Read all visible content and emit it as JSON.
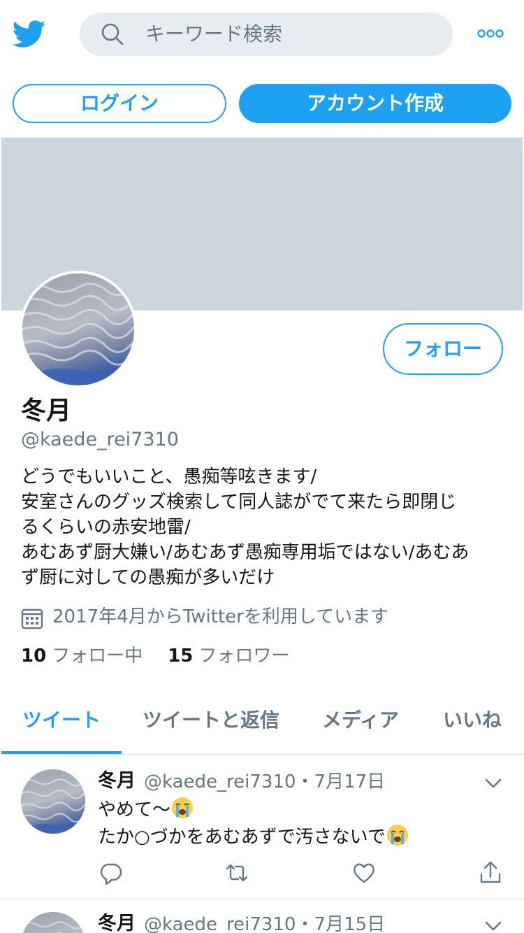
{
  "header": {
    "search_placeholder": "キーワード検索",
    "login_label": "ログイン",
    "signup_label": "アカウント作成"
  },
  "profile": {
    "name": "冬月",
    "handle": "@kaede_rei7310",
    "follow_label": "フォロー",
    "bio_lines": [
      "どうでもいいこと、愚痴等呟きます/",
      "安室さんのグッズ検索して同人誌がでて来たら即閉じ",
      "るくらいの赤安地雷/",
      "あむあず厨大嫌い/あむあず愚痴専用垢ではない/あむあ",
      "ず厨に対しての愚痴が多いだけ"
    ],
    "joined": "2017年4月からTwitterを利用しています",
    "following_count": "10",
    "following_label": "フォロー中",
    "followers_count": "15",
    "followers_label": "フォロワー"
  },
  "tabs": [
    {
      "label": "ツイート",
      "active": true
    },
    {
      "label": "ツイートと返信",
      "active": false
    },
    {
      "label": "メディア",
      "active": false
    },
    {
      "label": "いいね",
      "active": false
    }
  ],
  "tweets": [
    {
      "name": "冬月",
      "meta": "@kaede_rei7310・7月17日",
      "lines": [
        "やめて～",
        "たか○づかをあむあずで汚さないで"
      ],
      "emoji": "loudly-crying-face"
    },
    {
      "name": "冬月",
      "meta": "@kaede_rei7310・7月15日"
    }
  ],
  "icons": {
    "logo": "twitter-bird-icon",
    "search": "search-icon",
    "more": "more-dots-icon",
    "calendar": "calendar-icon",
    "chevron": "chevron-down-icon",
    "reply": "reply-icon",
    "retweet": "retweet-icon",
    "like": "heart-icon",
    "share": "share-icon"
  },
  "colors": {
    "accent": "#1da1f2",
    "muted_text": "#657786",
    "banner": "#ccd6dd",
    "search_bg": "#e6ecf0"
  }
}
